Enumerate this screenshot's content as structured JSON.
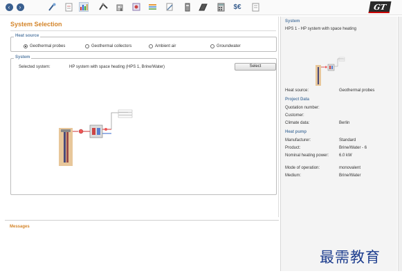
{
  "toolbar": {
    "back_icon": "arrow-left-icon",
    "forward_icon": "arrow-right-icon",
    "tool_icons": [
      "probe-icon",
      "document-icon",
      "chart-icon",
      "pipes-icon",
      "building-icon",
      "settings-icon",
      "weather-icon",
      "pen-icon",
      "device-icon",
      "panel-icon",
      "calculator-icon",
      "cost-icon",
      "print-icon"
    ],
    "cost_label": "$€",
    "logo": "GT"
  },
  "main": {
    "title": "System Selection",
    "heat_source": {
      "label": "Heat source",
      "options": [
        {
          "label": "Geothermal probes",
          "selected": true
        },
        {
          "label": "Geothermal collectors",
          "selected": false
        },
        {
          "label": "Ambient air",
          "selected": false
        },
        {
          "label": "Groundwater",
          "selected": false
        }
      ]
    },
    "system": {
      "label": "System",
      "selected_label": "Selected system:",
      "selected_value": "HP system with space heating (HPS 1, Brine/Water)",
      "select_button": "Select"
    }
  },
  "messages": {
    "title": "Messages"
  },
  "sidebar": {
    "system_heading": "System",
    "system_name": "HPS 1 - HP system with space heating",
    "heat_source_label": "Heat source:",
    "heat_source_value": "Geothermal probes",
    "project_heading": "Project Data",
    "quotation_label": "Quotation number:",
    "customer_label": "Customer:",
    "climate_label": "Climate data:",
    "climate_value": "Berlin",
    "heat_pump_heading": "Heat pump",
    "manufacturer_label": "Manufacturer:",
    "manufacturer_value": "Standard",
    "product_label": "Product:",
    "product_value": "Brine/Water - 6",
    "power_label": "Nominal heating power:",
    "power_value": "6.0 kW",
    "mode_label": "Mode of operation:",
    "mode_value": "monovalent",
    "medium_label": "Medium:",
    "medium_value": "Brine/Water"
  },
  "watermark": "最需教育",
  "colors": {
    "accent_orange": "#d4852a",
    "group_blue": "#5a7fa6",
    "nav_blue": "#3a5f8f"
  }
}
